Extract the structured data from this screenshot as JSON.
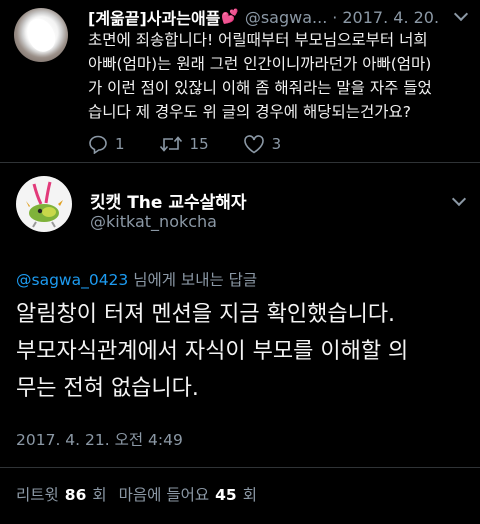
{
  "parent_tweet": {
    "display_name": "[계옮끝]사과는애플",
    "name_emoji_icon": "two-hearts-icon",
    "handle": "@sagwa...",
    "separator": "·",
    "date": "2017. 4. 20.",
    "text_lines": [
      "초면에 죄송합니다! 어릴때부터 부모님으로부터 너희",
      "아빠(엄마)는 원래 그런 인간이니까라던가 아빠(엄마)",
      "가 이런 점이 있잖니 이해 좀 해줘라는 말을 자주 들었",
      "습니다 제 경우도 위 글의 경우에 해당되는건가요?"
    ],
    "reply_count": "1",
    "retweet_count": "15",
    "like_count": "3"
  },
  "main_tweet": {
    "display_name": "킷캣 The 교수살해자",
    "handle": "@kitkat_nokcha",
    "reply_mention": "@sagwa_0423",
    "reply_suffix": " 님에게 보내는 답글",
    "text_lines": [
      "알림창이 터져 멘션을 지금 확인했습니다.",
      "부모자식관계에서 자식이 부모를 이해할 의",
      "무는 전혀 없습니다."
    ],
    "timestamp": "2017. 4. 21. 오전 4:49",
    "retweets_label": "리트윗",
    "retweets_count": "86",
    "retweets_unit": "회",
    "likes_label": "마음에 들어요",
    "likes_count": "45",
    "likes_unit": "회"
  },
  "colors": {
    "background": "#000000",
    "link": "#1d9bf0",
    "muted": "#8b98a5",
    "emoji_heart": "#ff4fb3"
  }
}
